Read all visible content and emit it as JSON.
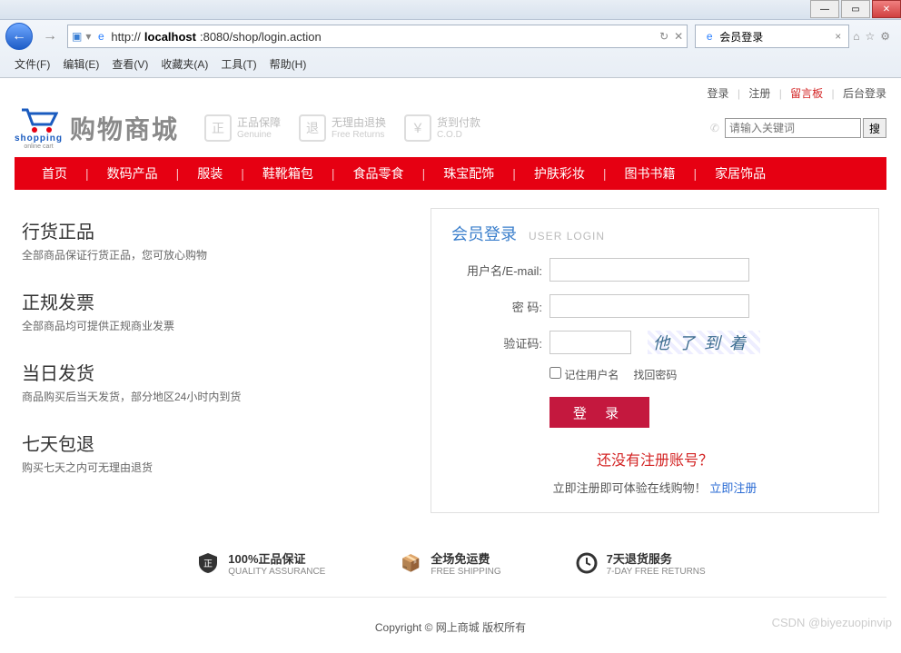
{
  "browser": {
    "url_prefix": "http://",
    "url_host": "localhost",
    "url_rest": ":8080/shop/login.action",
    "tab_title": "会员登录",
    "menus": [
      "文件(F)",
      "编辑(E)",
      "查看(V)",
      "收藏夹(A)",
      "工具(T)",
      "帮助(H)"
    ]
  },
  "top_links": {
    "login": "登录",
    "register": "注册",
    "board": "留言板",
    "admin": "后台登录"
  },
  "logo": {
    "title": "购物商城",
    "shopping": "shopping",
    "sub": "online cart"
  },
  "badges": [
    {
      "title": "正品保障",
      "sub": "Genuine",
      "icon": "正"
    },
    {
      "title": "无理由退换",
      "sub": "Free Returns",
      "icon": "退"
    },
    {
      "title": "货到付款",
      "sub": "C.O.D",
      "icon": "￥"
    }
  ],
  "search": {
    "placeholder": "请输入关键词",
    "value": "",
    "btn": "搜"
  },
  "nav": [
    "首页",
    "数码产品",
    "服装",
    "鞋靴箱包",
    "食品零食",
    "珠宝配饰",
    "护肤彩妆",
    "图书书籍",
    "家居饰品"
  ],
  "features": [
    {
      "title": "行货正品",
      "desc": "全部商品保证行货正品，您可放心购物"
    },
    {
      "title": "正规发票",
      "desc": "全部商品均可提供正规商业发票"
    },
    {
      "title": "当日发货",
      "desc": "商品购买后当天发货，部分地区24小时内到货"
    },
    {
      "title": "七天包退",
      "desc": "购买七天之内可无理由退货"
    }
  ],
  "login": {
    "title": "会员登录",
    "title_en": "USER LOGIN",
    "label_user": "用户名/E-mail:",
    "label_pwd": "密 码:",
    "label_captcha": "验证码:",
    "captcha_text": "他了到着",
    "remember": "记住用户名",
    "forgot": "找回密码",
    "btn": "登 录",
    "no_account": "还没有注册账号？",
    "register_hint": "立即注册即可体验在线购物！",
    "register_link": "立即注册"
  },
  "footer_badges": [
    {
      "title": "100%正品保证",
      "sub": "QUALITY ASSURANCE",
      "icon": "正"
    },
    {
      "title": "全场免运费",
      "sub": "FREE SHIPPING",
      "icon": "📦"
    },
    {
      "title": "7天退货服务",
      "sub": "7-DAY FREE RETURNS",
      "icon": "⟳"
    }
  ],
  "copyright": "Copyright © 网上商城 版权所有",
  "watermark": "CSDN @biyezuopinvip"
}
